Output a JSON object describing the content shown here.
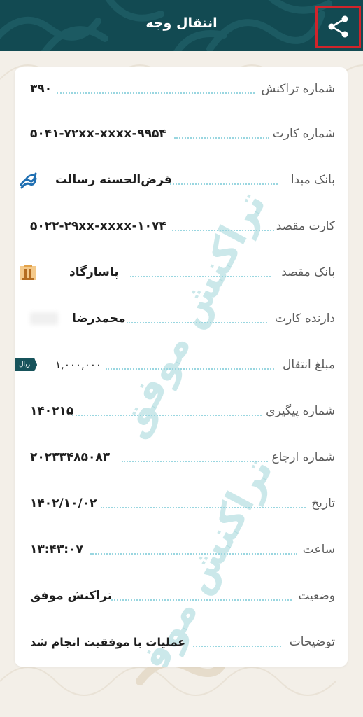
{
  "header": {
    "title": "انتقال وجه",
    "share_icon": "share-icon",
    "background_color": "#124a52",
    "highlight_color": "#d1242b"
  },
  "watermark": {
    "text": "تراکنش موفق",
    "color": "#a0d6d9"
  },
  "rows": [
    {
      "label": "شماره تراکنش",
      "value": "۳۹۰"
    },
    {
      "label": "شماره کارت",
      "value": "۵۰۴۱-۷۲xx-xxxx-۹۹۵۴"
    },
    {
      "label": "بانک مبدا",
      "value": "قرض‌الحسنه رسالت",
      "icon": "resalat-bank-logo"
    },
    {
      "label": "کارت مقصد",
      "value": "۵۰۲۲-۲۹xx-xxxx-۱۰۷۴"
    },
    {
      "label": "بانک مقصد",
      "value": "پاسارگاد",
      "icon": "pasargad-bank-logo"
    },
    {
      "label": "دارنده کارت",
      "value": "محمدرضا"
    },
    {
      "label": "مبلغ انتقال",
      "value": "۱,۰۰۰,۰۰۰",
      "badge": "ریال"
    },
    {
      "label": "شماره پیگیری",
      "value": "۱۴۰۲۱۵"
    },
    {
      "label": "شماره ارجاع",
      "value": "۲۰۲۳۳۴۸۵۰۸۳"
    },
    {
      "label": "تاریخ",
      "value": "۱۴۰۲/۱۰/۰۲"
    },
    {
      "label": "ساعت",
      "value": "۱۳:۴۳:۰۷"
    },
    {
      "label": "وضعیت",
      "value": "تراکنش موفق"
    },
    {
      "label": "توضیحات",
      "value": "عملیات با موفقیت انجام شد"
    }
  ]
}
